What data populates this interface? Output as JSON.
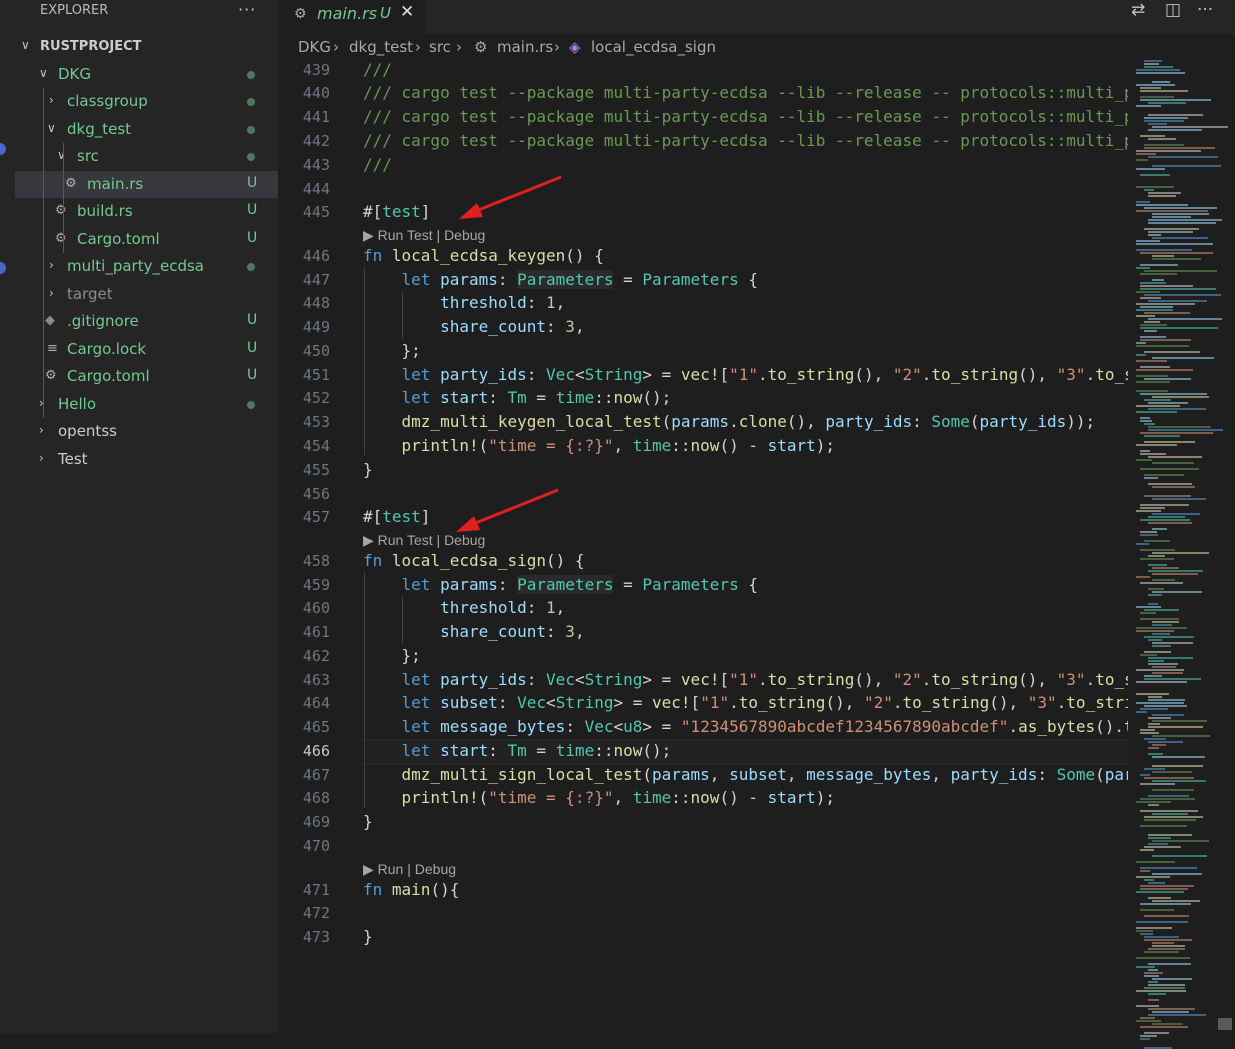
{
  "sidebar": {
    "title": "EXPLORER",
    "more": "···",
    "project": "RUSTPROJECT",
    "items": [
      {
        "label": "DKG",
        "status": "dot"
      },
      {
        "label": "classgroup",
        "status": "dot"
      },
      {
        "label": "dkg_test",
        "status": "dot"
      },
      {
        "label": "src",
        "status": "dot"
      },
      {
        "label": "main.rs",
        "status": "U"
      },
      {
        "label": "build.rs",
        "status": "U"
      },
      {
        "label": "Cargo.toml",
        "status": "U"
      },
      {
        "label": "multi_party_ecdsa",
        "status": "dot"
      },
      {
        "label": "target",
        "status": ""
      },
      {
        "label": ".gitignore",
        "status": "U"
      },
      {
        "label": "Cargo.lock",
        "status": "U"
      },
      {
        "label": "Cargo.toml",
        "status": "U"
      },
      {
        "label": "Hello",
        "status": "dot"
      },
      {
        "label": "opentss",
        "status": ""
      },
      {
        "label": "Test",
        "status": ""
      }
    ]
  },
  "tab": {
    "name": "main.rs",
    "modified": "U",
    "close": "✕"
  },
  "breadcrumb": [
    "DKG",
    "dkg_test",
    "src",
    "main.rs",
    "local_ecdsa_sign"
  ],
  "lens": {
    "run_test_debug": "Run Test | Debug",
    "run_debug": "Run | Debug"
  },
  "editor": {
    "line_numbers": [
      "439",
      "440",
      "441",
      "442",
      "443",
      "444",
      "445",
      "446",
      "447",
      "448",
      "449",
      "450",
      "451",
      "452",
      "453",
      "454",
      "455",
      "456",
      "457",
      "458",
      "459",
      "460",
      "461",
      "462",
      "463",
      "464",
      "465",
      "466",
      "467",
      "468",
      "469",
      "470",
      "471",
      "472",
      "473"
    ],
    "active_line": "466"
  }
}
